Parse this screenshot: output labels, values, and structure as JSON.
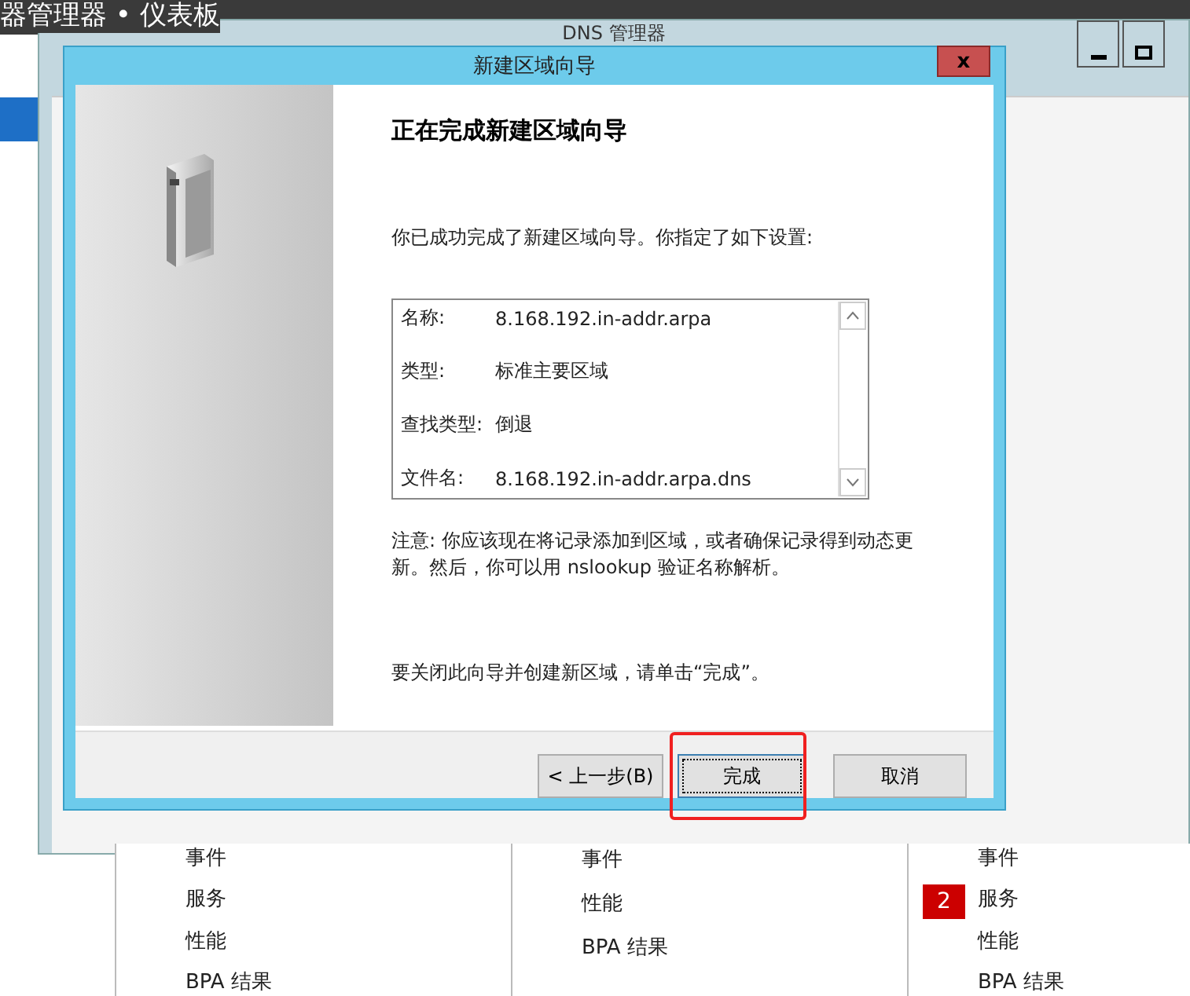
{
  "desktop": {
    "app_title": "器管理器 • 仪表板"
  },
  "background_window": {
    "title": "DNS 管理器"
  },
  "tiles": [
    {
      "items": [
        {
          "label": "事件"
        },
        {
          "label": "服务"
        },
        {
          "label": "性能"
        },
        {
          "label": "BPA 结果"
        }
      ]
    },
    {
      "items": [
        {
          "label": "事件"
        },
        {
          "label": "性能"
        },
        {
          "label": "BPA 结果"
        }
      ]
    },
    {
      "items": [
        {
          "label": "事件"
        },
        {
          "label": "服务",
          "badge": "2"
        },
        {
          "label": "性能"
        },
        {
          "label": "BPA 结果"
        }
      ]
    }
  ],
  "dialog": {
    "title": "新建区域向导",
    "close": "x",
    "heading": "正在完成新建区域向导",
    "intro": "你已成功完成了新建区域向导。你指定了如下设置:",
    "summary": [
      {
        "label": "名称:",
        "value": "8.168.192.in-addr.arpa"
      },
      {
        "label": "类型:",
        "value": "标准主要区域"
      },
      {
        "label": "查找类型:",
        "value": "倒退"
      },
      {
        "label": "文件名:",
        "value": "8.168.192.in-addr.arpa.dns"
      }
    ],
    "note": "注意: 你应该现在将记录添加到区域，或者确保记录得到动态更新。然后，你可以用 nslookup 验证名称解析。",
    "closing": "要关闭此向导并创建新区域，请单击“完成”。",
    "buttons": [
      {
        "label": "< 上一步(B)",
        "kind": "back",
        "focused": false,
        "highlighted": false
      },
      {
        "label": "完成",
        "kind": "finish",
        "focused": true,
        "highlighted": true
      },
      {
        "label": "取消",
        "kind": "cancel",
        "focused": false,
        "highlighted": false
      }
    ]
  }
}
